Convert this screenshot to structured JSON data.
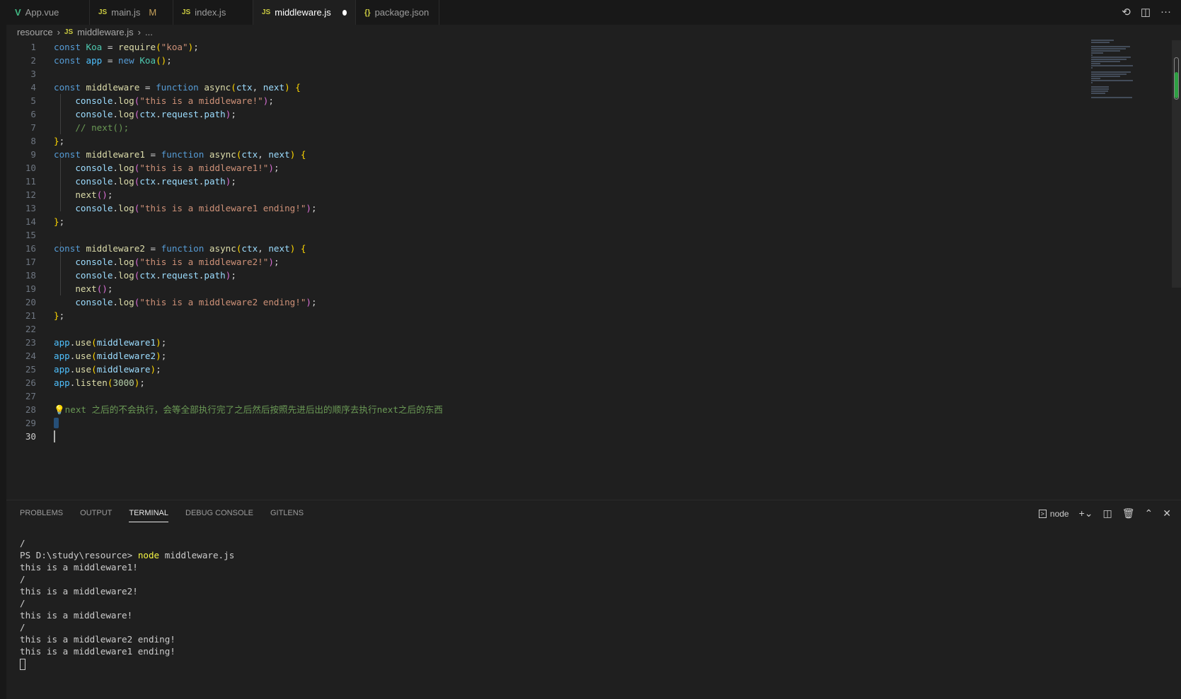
{
  "tabs": [
    {
      "label": "App.vue",
      "icon": "vue-icon",
      "glyph": "V"
    },
    {
      "label": "main.js",
      "icon": "js-icon",
      "glyph": "JS",
      "badge": "M"
    },
    {
      "label": "index.js",
      "icon": "js-icon",
      "glyph": "JS"
    },
    {
      "label": "middleware.js",
      "icon": "js-icon",
      "glyph": "JS",
      "active": true
    },
    {
      "label": "package.json",
      "icon": "json-icon",
      "glyph": "{}"
    }
  ],
  "breadcrumb": {
    "folder": "resource",
    "file": "middleware.js",
    "more": "...",
    "glyph": "JS"
  },
  "editor": {
    "current_line": 30,
    "lines": [
      [
        [
          "kw",
          "const "
        ],
        [
          "cls",
          "Koa"
        ],
        [
          "pn",
          " = "
        ],
        [
          "fn",
          "require"
        ],
        [
          "br",
          "("
        ],
        [
          "str",
          "\"koa\""
        ],
        [
          "br",
          ")"
        ],
        [
          "pn",
          ";"
        ]
      ],
      [
        [
          "kw",
          "const "
        ],
        [
          "vr",
          "app"
        ],
        [
          "pn",
          " = "
        ],
        [
          "kw",
          "new "
        ],
        [
          "cls",
          "Koa"
        ],
        [
          "br",
          "()"
        ],
        [
          "pn",
          ";"
        ]
      ],
      [],
      [
        [
          "kw",
          "const "
        ],
        [
          "fn",
          "middleware"
        ],
        [
          "pn",
          " = "
        ],
        [
          "kw",
          "function "
        ],
        [
          "fn",
          "async"
        ],
        [
          "br",
          "("
        ],
        [
          "var",
          "ctx"
        ],
        [
          "pn",
          ", "
        ],
        [
          "var",
          "next"
        ],
        [
          "br",
          ")"
        ],
        [
          "pn",
          " "
        ],
        [
          "br",
          "{"
        ]
      ],
      [
        [
          "pn",
          "    "
        ],
        [
          "var",
          "console"
        ],
        [
          "pn",
          "."
        ],
        [
          "fn",
          "log"
        ],
        [
          "br2",
          "("
        ],
        [
          "str",
          "\"this is a middleware!\""
        ],
        [
          "br2",
          ")"
        ],
        [
          "pn",
          ";"
        ]
      ],
      [
        [
          "pn",
          "    "
        ],
        [
          "var",
          "console"
        ],
        [
          "pn",
          "."
        ],
        [
          "fn",
          "log"
        ],
        [
          "br2",
          "("
        ],
        [
          "var",
          "ctx"
        ],
        [
          "pn",
          "."
        ],
        [
          "var",
          "request"
        ],
        [
          "pn",
          "."
        ],
        [
          "var",
          "path"
        ],
        [
          "br2",
          ")"
        ],
        [
          "pn",
          ";"
        ]
      ],
      [
        [
          "pn",
          "    "
        ],
        [
          "cm",
          "// next();"
        ]
      ],
      [
        [
          "br",
          "}"
        ],
        [
          "pn",
          ";"
        ]
      ],
      [
        [
          "kw",
          "const "
        ],
        [
          "fn",
          "middleware1"
        ],
        [
          "pn",
          " = "
        ],
        [
          "kw",
          "function "
        ],
        [
          "fn",
          "async"
        ],
        [
          "br",
          "("
        ],
        [
          "var",
          "ctx"
        ],
        [
          "pn",
          ", "
        ],
        [
          "var",
          "next"
        ],
        [
          "br",
          ")"
        ],
        [
          "pn",
          " "
        ],
        [
          "br",
          "{"
        ]
      ],
      [
        [
          "pn",
          "    "
        ],
        [
          "var",
          "console"
        ],
        [
          "pn",
          "."
        ],
        [
          "fn",
          "log"
        ],
        [
          "br2",
          "("
        ],
        [
          "str",
          "\"this is a middleware1!\""
        ],
        [
          "br2",
          ")"
        ],
        [
          "pn",
          ";"
        ]
      ],
      [
        [
          "pn",
          "    "
        ],
        [
          "var",
          "console"
        ],
        [
          "pn",
          "."
        ],
        [
          "fn",
          "log"
        ],
        [
          "br2",
          "("
        ],
        [
          "var",
          "ctx"
        ],
        [
          "pn",
          "."
        ],
        [
          "var",
          "request"
        ],
        [
          "pn",
          "."
        ],
        [
          "var",
          "path"
        ],
        [
          "br2",
          ")"
        ],
        [
          "pn",
          ";"
        ]
      ],
      [
        [
          "pn",
          "    "
        ],
        [
          "fn",
          "next"
        ],
        [
          "br2",
          "()"
        ],
        [
          "pn",
          ";"
        ]
      ],
      [
        [
          "pn",
          "    "
        ],
        [
          "var",
          "console"
        ],
        [
          "pn",
          "."
        ],
        [
          "fn",
          "log"
        ],
        [
          "br2",
          "("
        ],
        [
          "str",
          "\"this is a middleware1 ending!\""
        ],
        [
          "br2",
          ")"
        ],
        [
          "pn",
          ";"
        ]
      ],
      [
        [
          "br",
          "}"
        ],
        [
          "pn",
          ";"
        ]
      ],
      [],
      [
        [
          "kw",
          "const "
        ],
        [
          "fn",
          "middleware2"
        ],
        [
          "pn",
          " = "
        ],
        [
          "kw",
          "function "
        ],
        [
          "fn",
          "async"
        ],
        [
          "br",
          "("
        ],
        [
          "var",
          "ctx"
        ],
        [
          "pn",
          ", "
        ],
        [
          "var",
          "next"
        ],
        [
          "br",
          ")"
        ],
        [
          "pn",
          " "
        ],
        [
          "br",
          "{"
        ]
      ],
      [
        [
          "pn",
          "    "
        ],
        [
          "var",
          "console"
        ],
        [
          "pn",
          "."
        ],
        [
          "fn",
          "log"
        ],
        [
          "br2",
          "("
        ],
        [
          "str",
          "\"this is a middleware2!\""
        ],
        [
          "br2",
          ")"
        ],
        [
          "pn",
          ";"
        ]
      ],
      [
        [
          "pn",
          "    "
        ],
        [
          "var",
          "console"
        ],
        [
          "pn",
          "."
        ],
        [
          "fn",
          "log"
        ],
        [
          "br2",
          "("
        ],
        [
          "var",
          "ctx"
        ],
        [
          "pn",
          "."
        ],
        [
          "var",
          "request"
        ],
        [
          "pn",
          "."
        ],
        [
          "var",
          "path"
        ],
        [
          "br2",
          ")"
        ],
        [
          "pn",
          ";"
        ]
      ],
      [
        [
          "pn",
          "    "
        ],
        [
          "fn",
          "next"
        ],
        [
          "br2",
          "()"
        ],
        [
          "pn",
          ";"
        ]
      ],
      [
        [
          "pn",
          "    "
        ],
        [
          "var",
          "console"
        ],
        [
          "pn",
          "."
        ],
        [
          "fn",
          "log"
        ],
        [
          "br2",
          "("
        ],
        [
          "str",
          "\"this is a middleware2 ending!\""
        ],
        [
          "br2",
          ")"
        ],
        [
          "pn",
          ";"
        ]
      ],
      [
        [
          "br",
          "}"
        ],
        [
          "pn",
          ";"
        ]
      ],
      [],
      [
        [
          "vr",
          "app"
        ],
        [
          "pn",
          "."
        ],
        [
          "fn",
          "use"
        ],
        [
          "br",
          "("
        ],
        [
          "var",
          "middleware1"
        ],
        [
          "br",
          ")"
        ],
        [
          "pn",
          ";"
        ]
      ],
      [
        [
          "vr",
          "app"
        ],
        [
          "pn",
          "."
        ],
        [
          "fn",
          "use"
        ],
        [
          "br",
          "("
        ],
        [
          "var",
          "middleware2"
        ],
        [
          "br",
          ")"
        ],
        [
          "pn",
          ";"
        ]
      ],
      [
        [
          "vr",
          "app"
        ],
        [
          "pn",
          "."
        ],
        [
          "fn",
          "use"
        ],
        [
          "br",
          "("
        ],
        [
          "var",
          "middleware"
        ],
        [
          "br",
          ")"
        ],
        [
          "pn",
          ";"
        ]
      ],
      [
        [
          "vr",
          "app"
        ],
        [
          "pn",
          "."
        ],
        [
          "fn",
          "listen"
        ],
        [
          "br",
          "("
        ],
        [
          "num",
          "3000"
        ],
        [
          "br",
          ")"
        ],
        [
          "pn",
          ";"
        ]
      ],
      [],
      [
        [
          "cm",
          "💡next 之后的不会执行，会等全部执行完了之后然后按照先进后出的顺序去执行next之后的东西"
        ]
      ],
      [],
      []
    ]
  },
  "panel": {
    "tabs": [
      "PROBLEMS",
      "OUTPUT",
      "TERMINAL",
      "DEBUG CONSOLE",
      "GITLENS"
    ],
    "active_tab": "TERMINAL",
    "terminal_name": "node",
    "prompt": "PS D:\\study\\resource> ",
    "command": "node",
    "command_args": " middleware.js",
    "output_before": [
      "/"
    ],
    "output": [
      "this is a middleware1!",
      "/",
      "this is a middleware2!",
      "/",
      "this is a middleware!",
      "/",
      "this is a middleware2 ending!",
      "this is a middleware1 ending!"
    ]
  }
}
